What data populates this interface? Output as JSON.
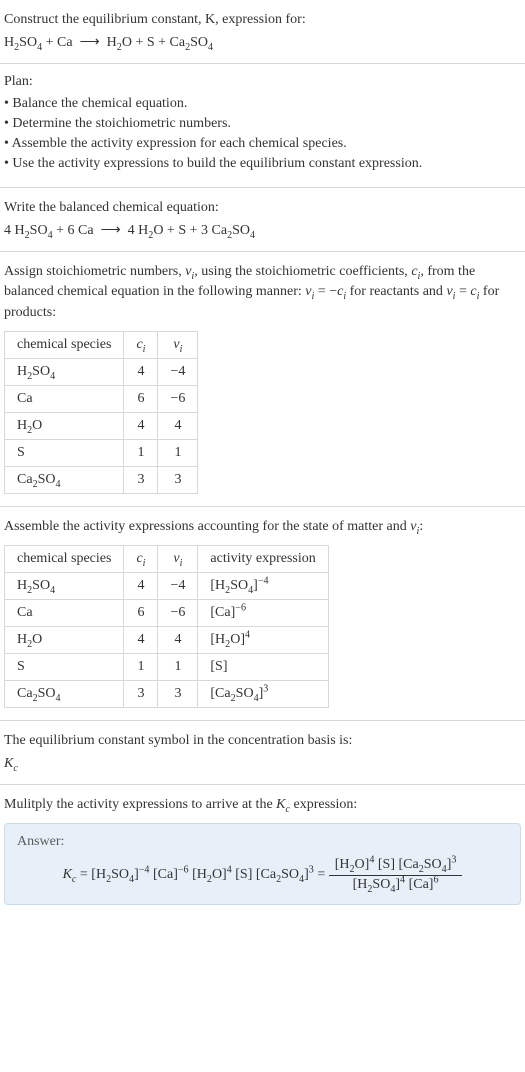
{
  "section1": {
    "prompt": "Construct the equilibrium constant, K, expression for:",
    "equation_html": "H<sub>2</sub>SO<sub>4</sub> + Ca &nbsp;⟶&nbsp; H<sub>2</sub>O + S + Ca<sub>2</sub>SO<sub>4</sub>"
  },
  "plan": {
    "title": "Plan:",
    "items": [
      "Balance the chemical equation.",
      "Determine the stoichiometric numbers.",
      "Assemble the activity expression for each chemical species.",
      "Use the activity expressions to build the equilibrium constant expression."
    ]
  },
  "balanced": {
    "intro": "Write the balanced chemical equation:",
    "equation_html": "4 H<sub>2</sub>SO<sub>4</sub> + 6 Ca &nbsp;⟶&nbsp; 4 H<sub>2</sub>O + S + 3 Ca<sub>2</sub>SO<sub>4</sub>"
  },
  "stoich": {
    "intro_html": "Assign stoichiometric numbers, <span class='ital'>ν<sub>i</sub></span>, using the stoichiometric coefficients, <span class='ital'>c<sub>i</sub></span>, from the balanced chemical equation in the following manner: <span class='ital'>ν<sub>i</sub></span> = −<span class='ital'>c<sub>i</sub></span> for reactants and <span class='ital'>ν<sub>i</sub></span> = <span class='ital'>c<sub>i</sub></span> for products:",
    "headers": {
      "species": "chemical species",
      "ci_html": "<span class='ital'>c<sub>i</sub></span>",
      "vi_html": "<span class='ital'>ν<sub>i</sub></span>"
    },
    "rows": [
      {
        "species_html": "H<sub>2</sub>SO<sub>4</sub>",
        "ci": "4",
        "vi": "−4"
      },
      {
        "species_html": "Ca",
        "ci": "6",
        "vi": "−6"
      },
      {
        "species_html": "H<sub>2</sub>O",
        "ci": "4",
        "vi": "4"
      },
      {
        "species_html": "S",
        "ci": "1",
        "vi": "1"
      },
      {
        "species_html": "Ca<sub>2</sub>SO<sub>4</sub>",
        "ci": "3",
        "vi": "3"
      }
    ]
  },
  "activity": {
    "intro_html": "Assemble the activity expressions accounting for the state of matter and <span class='ital'>ν<sub>i</sub></span>:",
    "headers": {
      "species": "chemical species",
      "ci_html": "<span class='ital'>c<sub>i</sub></span>",
      "vi_html": "<span class='ital'>ν<sub>i</sub></span>",
      "act": "activity expression"
    },
    "rows": [
      {
        "species_html": "H<sub>2</sub>SO<sub>4</sub>",
        "ci": "4",
        "vi": "−4",
        "act_html": "[H<sub>2</sub>SO<sub>4</sub>]<sup>−4</sup>"
      },
      {
        "species_html": "Ca",
        "ci": "6",
        "vi": "−6",
        "act_html": "[Ca]<sup>−6</sup>"
      },
      {
        "species_html": "H<sub>2</sub>O",
        "ci": "4",
        "vi": "4",
        "act_html": "[H<sub>2</sub>O]<sup>4</sup>"
      },
      {
        "species_html": "S",
        "ci": "1",
        "vi": "1",
        "act_html": "[S]"
      },
      {
        "species_html": "Ca<sub>2</sub>SO<sub>4</sub>",
        "ci": "3",
        "vi": "3",
        "act_html": "[Ca<sub>2</sub>SO<sub>4</sub>]<sup>3</sup>"
      }
    ]
  },
  "symbol": {
    "intro": "The equilibrium constant symbol in the concentration basis is:",
    "kc_html": "<span class='ital'>K<sub>c</sub></span>"
  },
  "final": {
    "intro_html": "Mulitply the activity expressions to arrive at the <span class='ital'>K<sub>c</sub></span> expression:",
    "answer_label": "Answer:",
    "expression_html": "<span class='nowrap'><span class='ital'>K<sub>c</sub></span> = [H<sub>2</sub>SO<sub>4</sub>]<sup>−4</sup> [Ca]<sup>−6</sup> [H<sub>2</sub>O]<sup>4</sup> [S] [Ca<sub>2</sub>SO<sub>4</sub>]<sup>3</sup> = <span class='frac'><span class='num'>[H<sub>2</sub>O]<sup>4</sup> [S] [Ca<sub>2</sub>SO<sub>4</sub>]<sup>3</sup></span><span class='den'>[H<sub>2</sub>SO<sub>4</sub>]<sup>4</sup> [Ca]<sup>6</sup></span></span></span>"
  }
}
